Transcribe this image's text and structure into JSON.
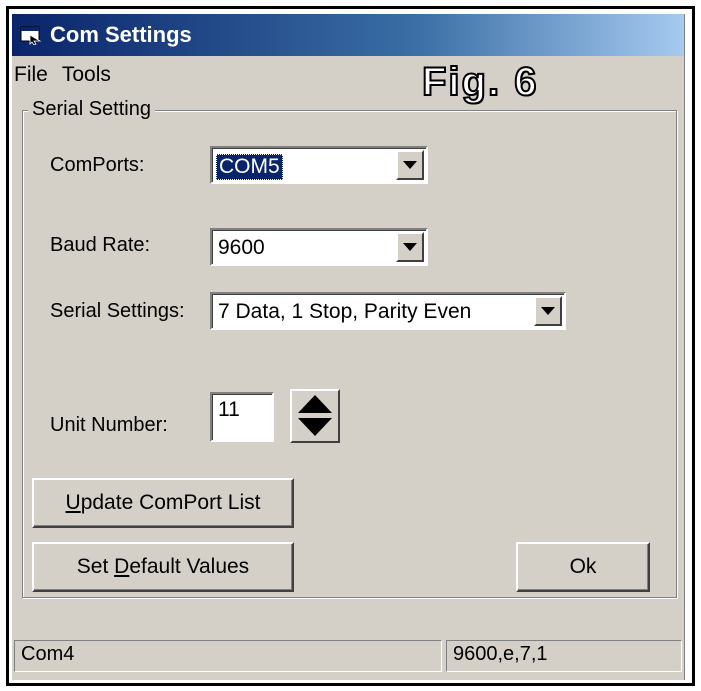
{
  "window": {
    "title": "Com Settings",
    "icon": "app-window-icon"
  },
  "menu": {
    "items": [
      "File",
      "Tools"
    ]
  },
  "figure_label": "Fig. 6",
  "group": {
    "legend": "Serial Setting",
    "comports": {
      "label": "ComPorts:",
      "value": "COM5"
    },
    "baud": {
      "label": "Baud Rate:",
      "value": "9600"
    },
    "serial": {
      "label": "Serial Settings:",
      "value": "7 Data, 1 Stop, Parity Even"
    },
    "unit": {
      "label": "Unit Number:",
      "value": "11"
    },
    "update_button": {
      "mnemonic": "U",
      "rest": "pdate ComPort List"
    },
    "default_button": {
      "pre": "Set ",
      "mnemonic": "D",
      "rest": "efault Values"
    },
    "ok_button": "Ok"
  },
  "status": {
    "left": "Com4",
    "right": "9600,e,7,1"
  },
  "colors": {
    "titlebar_start": "#0a246a",
    "face": "#d4d0c8",
    "selection": "#0a246a"
  }
}
